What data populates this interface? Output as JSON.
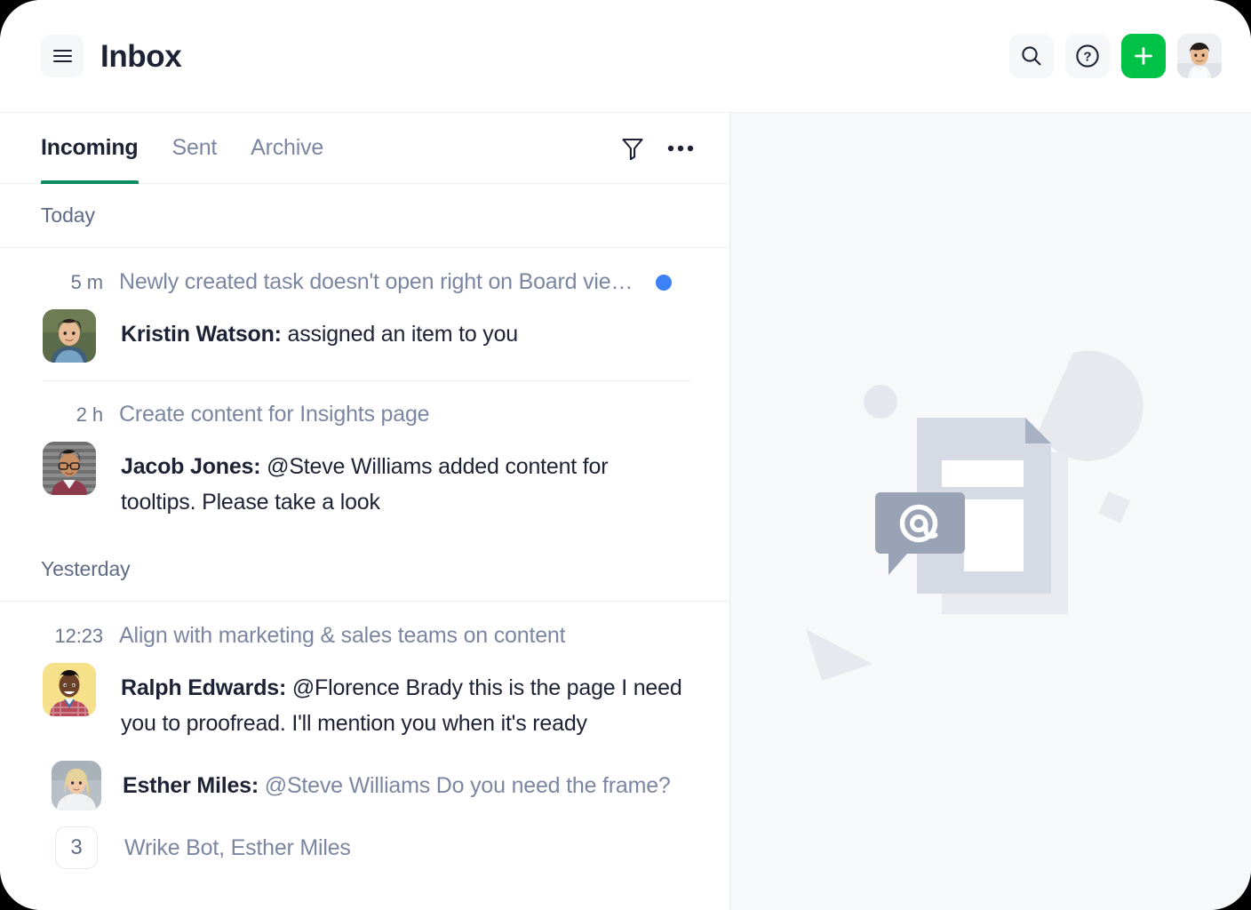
{
  "header": {
    "title": "Inbox",
    "menu_icon": "hamburger-icon",
    "actions": [
      {
        "name": "search",
        "icon": "search-icon",
        "label": "Search"
      },
      {
        "name": "help",
        "icon": "question-circle-icon",
        "label": "Help"
      },
      {
        "name": "create",
        "icon": "plus-icon",
        "label": "Create"
      }
    ],
    "avatar_label": "Account"
  },
  "tabs": [
    {
      "label": "Incoming",
      "active": true
    },
    {
      "label": "Sent",
      "active": false
    },
    {
      "label": "Archive",
      "active": false
    }
  ],
  "tab_actions": [
    {
      "name": "filter",
      "icon": "filter-icon"
    },
    {
      "name": "more",
      "icon": "more-horizontal-icon"
    }
  ],
  "sections": [
    {
      "label": "Today",
      "messages": [
        {
          "time": "5 m",
          "subject": "Newly created task doesn't open right on Board vie…",
          "unread": true,
          "author": "Kristin Watson:",
          "text": "assigned an item to you",
          "muted": false
        },
        {
          "time": "2 h",
          "subject": "Create content for Insights page",
          "unread": false,
          "author": "Jacob Jones:",
          "text": "@Steve Williams added content for tooltips. Please take a look",
          "muted": false
        }
      ]
    },
    {
      "label": "Yesterday",
      "messages": [
        {
          "time": "12:23",
          "subject": "Align with marketing & sales teams on content",
          "unread": false,
          "author": "Ralph Edwards:",
          "text": "@Florence Brady this is the page I need you to proofread. I'll mention you when it's ready",
          "muted": false,
          "reply": {
            "author": "Esther Miles:",
            "text": "@Steve Williams Do you need the frame?",
            "muted": true
          },
          "thread": {
            "count": "3",
            "names": "Wrike Bot, Esther Miles"
          }
        }
      ]
    }
  ],
  "detail": {
    "illustration": "at-mention-document-illustration"
  },
  "colors": {
    "accent_green": "#00c246",
    "tab_underline": "#0c8b5d",
    "unread_blue": "#3c81f6",
    "text_dark": "#1d2235",
    "text_muted": "#7b86a1",
    "panel_bg": "#f7f8fa"
  }
}
